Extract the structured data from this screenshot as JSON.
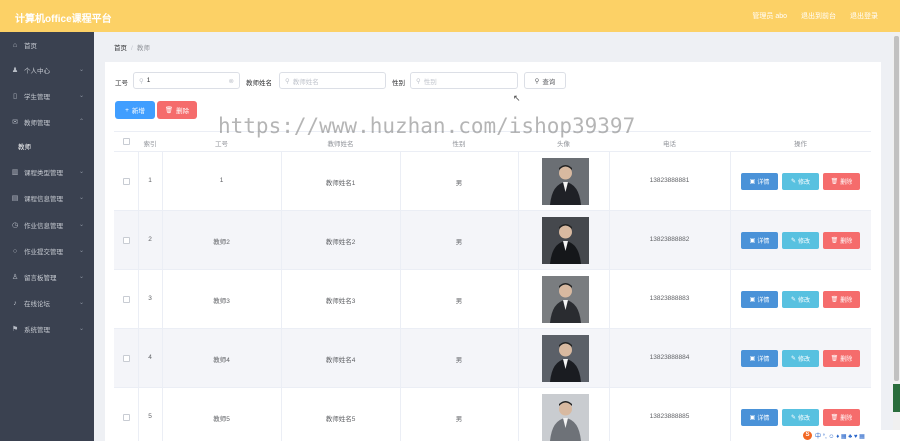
{
  "header": {
    "title": "计算机office课程平台",
    "links": [
      "管理员 abo",
      "退出到前台",
      "退出登录"
    ]
  },
  "sidebar": {
    "items": [
      {
        "label": "首页",
        "icon": "home-icon",
        "glyph": "⌂",
        "chevron": false
      },
      {
        "label": "个人中心",
        "icon": "user-icon",
        "glyph": "♟",
        "chevron": true
      },
      {
        "label": "学生管理",
        "icon": "phone-icon",
        "glyph": "▯",
        "chevron": true
      },
      {
        "label": "教师管理",
        "icon": "mail-icon",
        "glyph": "✉",
        "chevron": true
      },
      {
        "label": "教师",
        "sub": true
      },
      {
        "label": "课程类型管理",
        "icon": "chart-icon",
        "glyph": "▥",
        "chevron": true
      },
      {
        "label": "课程信息管理",
        "icon": "doc-icon",
        "glyph": "▤",
        "chevron": true
      },
      {
        "label": "作业信息管理",
        "icon": "clock-icon",
        "glyph": "◷",
        "chevron": true
      },
      {
        "label": "作业提交管理",
        "icon": "circle-icon",
        "glyph": "○",
        "chevron": true
      },
      {
        "label": "留言板管理",
        "icon": "person-icon",
        "glyph": "♙",
        "chevron": true
      },
      {
        "label": "在线论坛",
        "icon": "mic-icon",
        "glyph": "♪",
        "chevron": true
      },
      {
        "label": "系统管理",
        "icon": "flag-icon",
        "glyph": "⚑",
        "chevron": true
      }
    ]
  },
  "breadcrumb": {
    "home": "首页",
    "separator": "/",
    "current": "教师"
  },
  "search": {
    "id_label": "工号",
    "id_value": "1",
    "name_label": "教师姓名",
    "name_placeholder": "教师姓名",
    "gender_label": "性别",
    "gender_placeholder": "性别",
    "search_button": "查询"
  },
  "toolbar": {
    "add_label": "新增",
    "delete_label": "删除"
  },
  "table": {
    "headers": {
      "index": "索引",
      "id": "工号",
      "name": "教师姓名",
      "gender": "性别",
      "photo": "头像",
      "phone": "电话",
      "actions": "操作"
    },
    "actions": {
      "detail": "详情",
      "edit": "修改",
      "delete": "删除"
    },
    "rows": [
      {
        "index": "1",
        "id": "1",
        "name": "教师姓名1",
        "gender": "男",
        "phone": "13823888881"
      },
      {
        "index": "2",
        "id": "教师2",
        "name": "教师姓名2",
        "gender": "男",
        "phone": "13823888882"
      },
      {
        "index": "3",
        "id": "教师3",
        "name": "教师姓名3",
        "gender": "男",
        "phone": "13823888883"
      },
      {
        "index": "4",
        "id": "教师4",
        "name": "教师姓名4",
        "gender": "男",
        "phone": "13823888884"
      },
      {
        "index": "5",
        "id": "教师5",
        "name": "教师姓名5",
        "gender": "男",
        "phone": "13823888885"
      }
    ]
  },
  "watermark": "https://www.huzhan.com/ishop39397",
  "tray": {
    "text": "中 °, ☺ ♦ ▦ ♣ ♥ ▦"
  },
  "colors": {
    "topbar": "#fcd166",
    "sidebar": "#3a4150",
    "primary": "#409eff",
    "danger": "#f56c6c",
    "info": "#58c1e0"
  }
}
